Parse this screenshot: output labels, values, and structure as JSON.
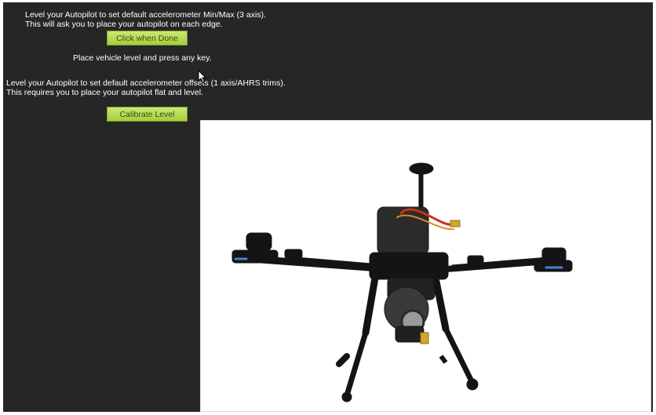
{
  "min_max": {
    "line1": "Level your Autopilot to set default accelerometer Min/Max (3 axis).",
    "line2": "This will ask you to place your autopilot on each edge.",
    "button_label": "Click when Done",
    "status": "Place vehicle level and press any key."
  },
  "level": {
    "line1": "Level your Autopilot to set default accelerometer offsets (1 axis/AHRS trims).",
    "line2": "This requires you to place your autopilot flat and level.",
    "button_label": "Calibrate Level"
  },
  "colors": {
    "panel_bg": "#262626",
    "button_green": "#b5d84c",
    "text": "#ffffff"
  },
  "icons": {
    "cursor": "mouse-pointer-icon",
    "photo": "quadcopter-drone-image"
  }
}
